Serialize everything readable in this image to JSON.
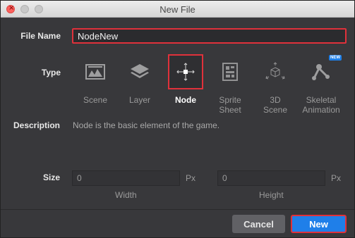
{
  "window": {
    "title": "New File"
  },
  "form": {
    "file_name_label": "File Name",
    "file_name_value": "NodeNew",
    "type_label": "Type",
    "description_label": "Description",
    "description_text": "Node is the basic element of the game.",
    "size_label": "Size"
  },
  "types": [
    {
      "label": "Scene",
      "icon": "scene-icon",
      "selected": false
    },
    {
      "label": "Layer",
      "icon": "layer-icon",
      "selected": false
    },
    {
      "label": "Node",
      "icon": "node-icon",
      "selected": true
    },
    {
      "label": "Sprite\nSheet",
      "icon": "sprite-sheet-icon",
      "selected": false
    },
    {
      "label": "3D\nScene",
      "icon": "3d-scene-icon",
      "selected": false
    },
    {
      "label": "Skeletal\nAnimation",
      "icon": "skeletal-animation-icon",
      "selected": false,
      "badge": "NEW"
    }
  ],
  "size": {
    "width_value": "0",
    "height_value": "0",
    "width_unit": "Px",
    "height_unit": "Px",
    "width_label": "Width",
    "height_label": "Height"
  },
  "buttons": {
    "cancel": "Cancel",
    "new": "New"
  },
  "colors": {
    "accent": "#1f7fe9",
    "selection": "#e0313b",
    "background": "#38383b"
  }
}
